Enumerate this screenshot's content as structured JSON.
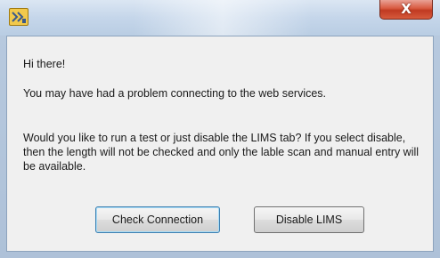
{
  "window": {
    "title": "",
    "close_glyph": "X",
    "icon": "app-icon"
  },
  "dialog": {
    "greeting": "Hi there!",
    "problem": "You may have had a problem connecting to the web services.",
    "question": "Would you like to run a test or just disable the LIMS tab? If you select disable, then the length will not be checked and only the lable scan and manual entry will be available."
  },
  "buttons": {
    "check_connection": "Check Connection",
    "disable_lims": "Disable LIMS"
  },
  "colors": {
    "close_button": "#c7432a",
    "default_button_border": "#3c7fb1",
    "dialog_background": "#f0f0f0"
  }
}
